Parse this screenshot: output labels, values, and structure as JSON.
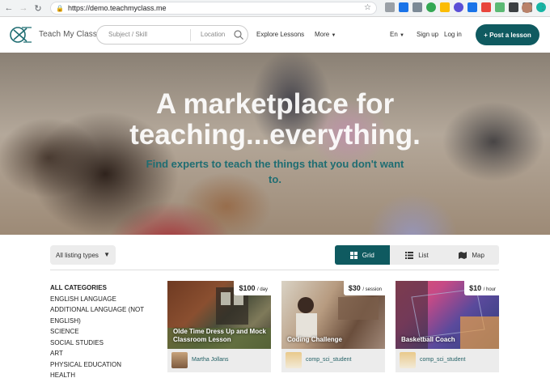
{
  "browser": {
    "url": "https://demo.teachmyclass.me",
    "back_icon": "arrow-left-icon",
    "forward_icon": "arrow-right-icon",
    "reload_icon": "reload-icon",
    "menu_icon": "kebab-menu-icon"
  },
  "header": {
    "logo_text": "Teach My Class",
    "search": {
      "subject_placeholder": "Subject / Skill",
      "location_placeholder": "Location"
    },
    "nav": {
      "explore": "Explore Lessons",
      "more": "More",
      "language": "En",
      "signup": "Sign up",
      "login": "Log in"
    },
    "post_button": "+ Post a lesson"
  },
  "hero": {
    "title_line1": "A marketplace for",
    "title_line2": "teaching...everything.",
    "subtitle_line1": "Find experts to teach the things that you don't want",
    "subtitle_line2": "to."
  },
  "controls": {
    "listing_types": "All listing types",
    "views": [
      {
        "label": "Grid",
        "icon": "grid-icon",
        "active": true
      },
      {
        "label": "List",
        "icon": "list-icon",
        "active": false
      },
      {
        "label": "Map",
        "icon": "map-icon",
        "active": false
      }
    ]
  },
  "categories": {
    "heading": "ALL CATEGORIES",
    "items": [
      "ENGLISH LANGUAGE",
      "ADDITIONAL LANGUAGE (NOT ENGLISH)",
      "SCIENCE",
      "SOCIAL STUDIES",
      "ART",
      "PHYSICAL EDUCATION",
      "HEALTH"
    ]
  },
  "listings": [
    {
      "price": "$100",
      "unit": "/ day",
      "title": "Olde Time Dress Up and Mock Classroom Lesson",
      "author": "Martha Jollans"
    },
    {
      "price": "$30",
      "unit": "/ session",
      "title": "Coding Challenge",
      "author": "comp_sci_student"
    },
    {
      "price": "$10",
      "unit": "/ hour",
      "title": "Basketball Coach",
      "author": "comp_sci_student"
    }
  ],
  "colors": {
    "brand": "#0f5a60",
    "hero_subtitle": "#1f6d72",
    "control_bg": "#ececec"
  }
}
